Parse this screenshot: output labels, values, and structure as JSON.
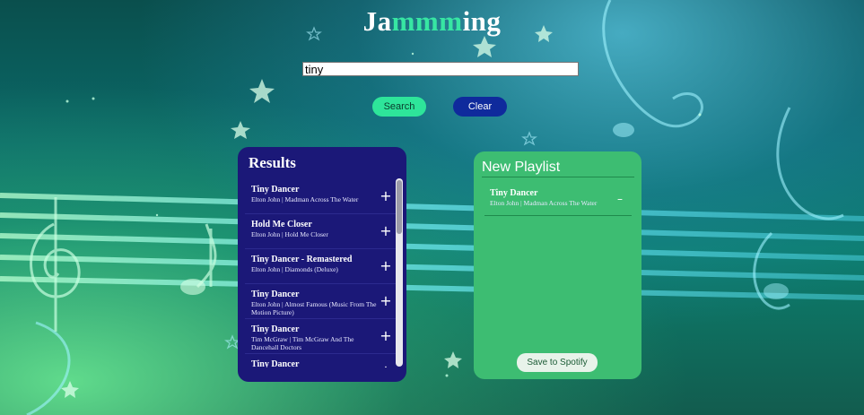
{
  "app": {
    "title_prefix": "Ja",
    "title_accent": "mmm",
    "title_suffix": "ing"
  },
  "search": {
    "value": "tiny",
    "search_label": "Search",
    "clear_label": "Clear"
  },
  "results": {
    "title": "Results",
    "tracks": [
      {
        "name": "Tiny Dancer",
        "meta": "Elton John | Madman Across The Water",
        "action": "+"
      },
      {
        "name": "Hold Me Closer",
        "meta": "Elton John | Hold Me Closer",
        "action": "+"
      },
      {
        "name": "Tiny Dancer - Remastered",
        "meta": "Elton John | Diamonds (Deluxe)",
        "action": "+"
      },
      {
        "name": "Tiny Dancer",
        "meta": "Elton John | Almost Famous (Music From The Motion Picture)",
        "action": "+"
      },
      {
        "name": "Tiny Dancer",
        "meta": "Tim McGraw | Tim McGraw And The Dancehall Doctors",
        "action": "+"
      },
      {
        "name": "Tiny Dancer",
        "meta": "",
        "action": "+"
      }
    ]
  },
  "playlist": {
    "name_value": "New Playlist",
    "tracks": [
      {
        "name": "Tiny Dancer",
        "meta": "Elton John | Madman Across The Water",
        "action": "–"
      }
    ],
    "save_label": "Save to Spotify"
  },
  "icons": {
    "add": "plus-icon",
    "remove": "minus-icon"
  },
  "colors": {
    "accent": "#37e6a3",
    "results_bg": "#1b1878",
    "playlist_bg": "#3dbd72",
    "search_button": "#2ee59a",
    "clear_button": "#0f2a9c"
  }
}
